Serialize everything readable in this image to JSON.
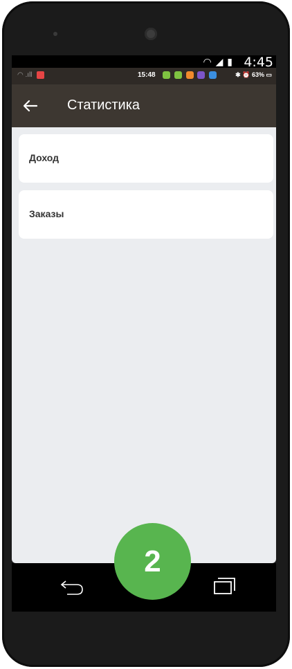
{
  "outer_status": {
    "time": "4:45"
  },
  "app_status": {
    "time": "15:48",
    "battery": "63%"
  },
  "toolbar": {
    "title": "Статистика"
  },
  "menu": {
    "items": [
      {
        "label": "Доход"
      },
      {
        "label": "Заказы"
      }
    ]
  },
  "step_badge": {
    "number": "2",
    "color": "#58b54f"
  },
  "colors": {
    "toolbar": "#3d3731",
    "statusbar": "#2f2a26",
    "screen_bg": "#ebedf0"
  }
}
